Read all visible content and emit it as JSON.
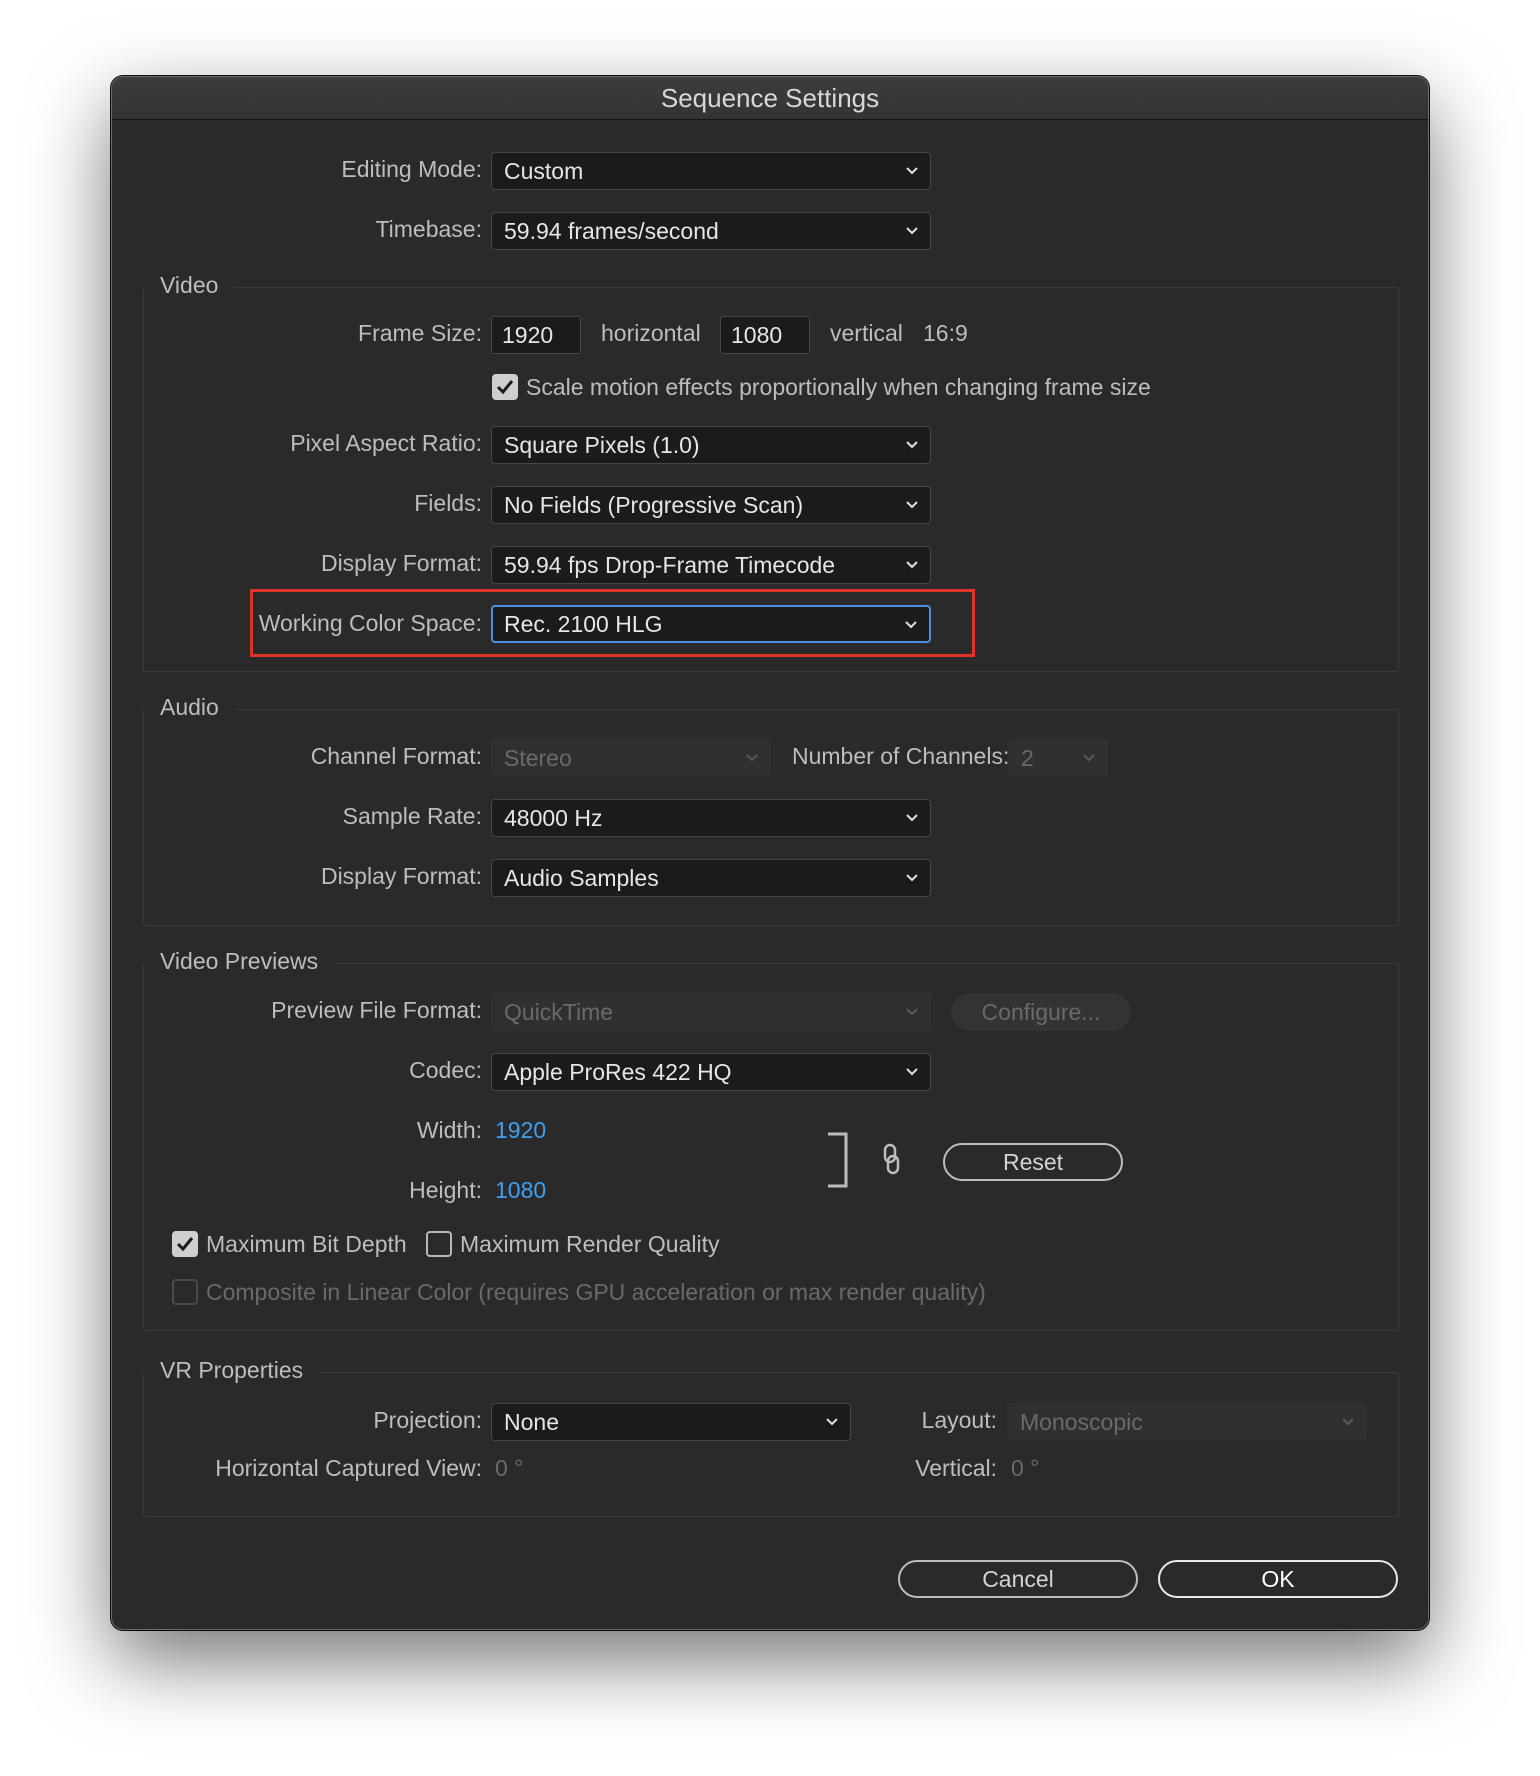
{
  "window": {
    "title": "Sequence Settings"
  },
  "top": {
    "editing_mode": {
      "label": "Editing Mode:",
      "value": "Custom"
    },
    "timebase": {
      "label": "Timebase:",
      "value": "59.94  frames/second"
    }
  },
  "video": {
    "title": "Video",
    "frame_size": {
      "label": "Frame Size:",
      "horizontal_value": "1920",
      "horizontal_label": "horizontal",
      "vertical_value": "1080",
      "vertical_label": "vertical",
      "aspect": "16:9"
    },
    "scale_motion": {
      "label": "Scale motion effects proportionally when changing frame size",
      "checked": true
    },
    "pixel_aspect_ratio": {
      "label": "Pixel Aspect Ratio:",
      "value": "Square Pixels (1.0)"
    },
    "fields": {
      "label": "Fields:",
      "value": "No Fields (Progressive Scan)"
    },
    "display_format": {
      "label": "Display Format:",
      "value": "59.94 fps Drop-Frame Timecode"
    },
    "working_color_space": {
      "label": "Working Color Space:",
      "value": "Rec. 2100 HLG",
      "highlight_color": "#e0342a"
    }
  },
  "audio": {
    "title": "Audio",
    "channel_format": {
      "label": "Channel Format:",
      "value": "Stereo"
    },
    "number_of_channels": {
      "label": "Number of Channels:",
      "value": "2"
    },
    "sample_rate": {
      "label": "Sample Rate:",
      "value": "48000 Hz"
    },
    "display_format": {
      "label": "Display Format:",
      "value": "Audio Samples"
    }
  },
  "video_previews": {
    "title": "Video Previews",
    "preview_file_format": {
      "label": "Preview File Format:",
      "value": "QuickTime"
    },
    "configure_button": "Configure...",
    "codec": {
      "label": "Codec:",
      "value": "Apple ProRes 422 HQ"
    },
    "width": {
      "label": "Width:",
      "value": "1920"
    },
    "height": {
      "label": "Height:",
      "value": "1080"
    },
    "reset_button": "Reset",
    "max_bit_depth": {
      "label": "Maximum Bit Depth",
      "checked": true
    },
    "max_render_quality": {
      "label": "Maximum Render Quality",
      "checked": false
    },
    "composite_linear": {
      "label": "Composite in Linear Color (requires GPU acceleration or max render quality)",
      "checked": false
    }
  },
  "vr": {
    "title": "VR Properties",
    "projection": {
      "label": "Projection:",
      "value": "None"
    },
    "layout": {
      "label": "Layout:",
      "value": "Monoscopic"
    },
    "horizontal_captured_view": {
      "label": "Horizontal Captured View:",
      "value": "0 °"
    },
    "vertical": {
      "label": "Vertical:",
      "value": "0 °"
    }
  },
  "footer": {
    "cancel": "Cancel",
    "ok": "OK"
  },
  "colors": {
    "accent_blue": "#3ea0f0",
    "focus_border": "#4a8fe0",
    "dialog_bg": "#2a2a2a"
  }
}
